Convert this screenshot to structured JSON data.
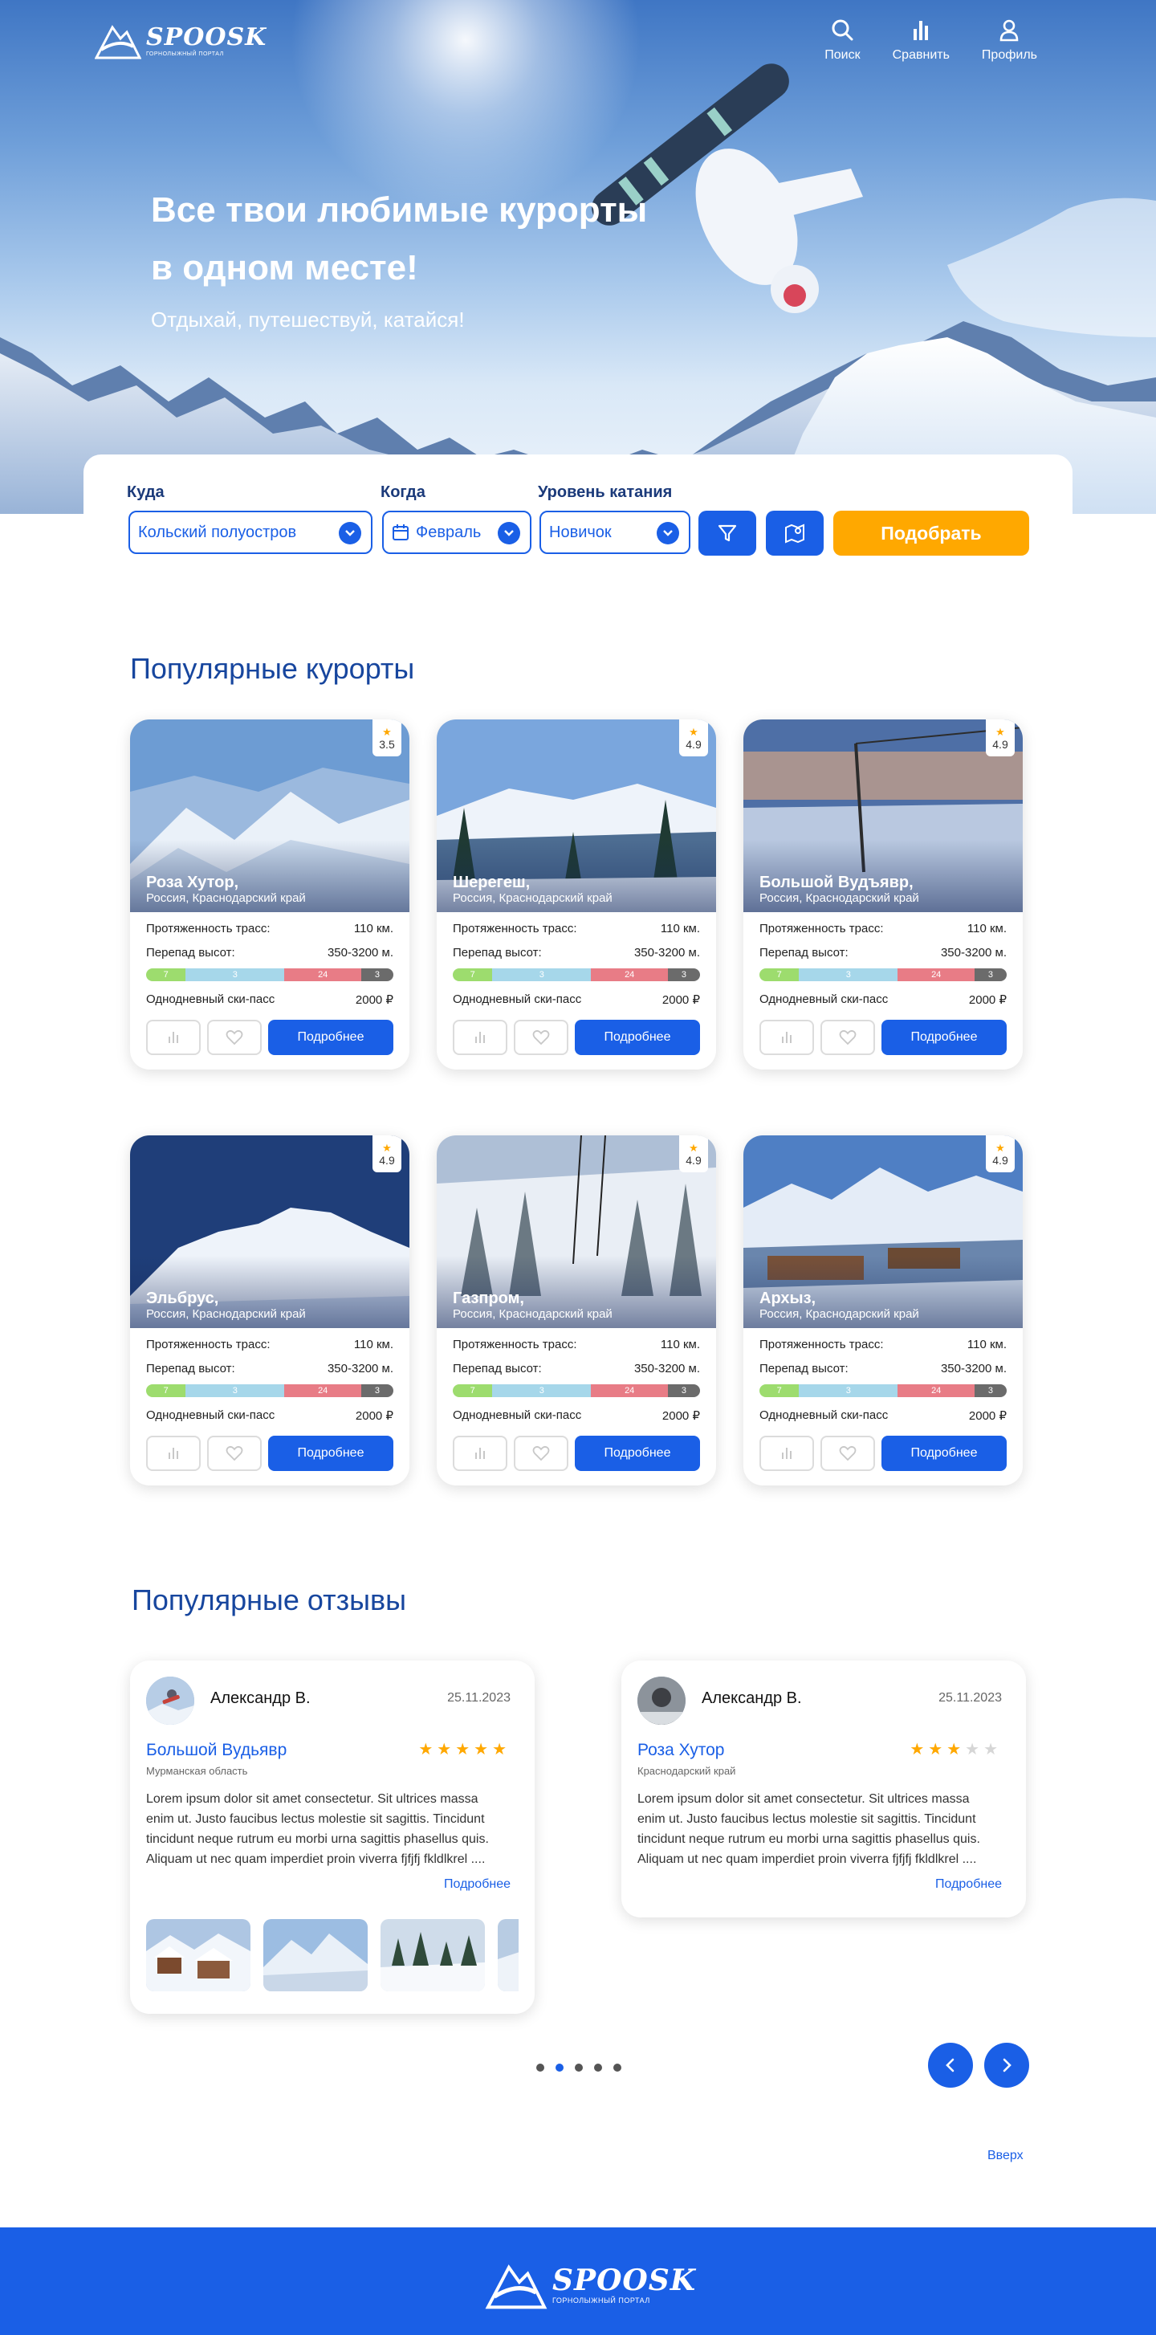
{
  "brand": {
    "name": "SPOOSK",
    "tagline": "ГОРНОЛЫЖНЫЙ ПОРТАЛ",
    "logo_icon": "mountain-ski-logo"
  },
  "nav": [
    {
      "label": "Поиск",
      "icon": "search-icon"
    },
    {
      "label": "Сравнить",
      "icon": "bar-chart-icon"
    },
    {
      "label": "Профиль",
      "icon": "user-icon"
    }
  ],
  "hero": {
    "title": "Все твои любимые курорты в одном месте!",
    "subtitle": "Отдыхай, путешествуй, катайся!"
  },
  "search": {
    "where_label": "Куда",
    "where_value": "Кольский полуостров",
    "when_label": "Когда",
    "when_value": "Февраль",
    "level_label": "Уровень катания",
    "level_value": "Новичок",
    "filter_icon": "filter-icon",
    "map_icon": "map-pin-icon",
    "submit_label": "Подобрать"
  },
  "resorts_section": {
    "title": "Популярные курорты"
  },
  "resort_labels": {
    "length": "Протяженность трасс:",
    "elevation": "Перепад высот:",
    "skipass": "Однодневный ски-пасс",
    "more": "Подробнее"
  },
  "slope_colors": {
    "green": "#9ddc6e",
    "blue": "#a6d7ea",
    "red": "#e87c86",
    "black": "#6b6b6b"
  },
  "resorts": [
    {
      "name": "Роза Хутор,",
      "region": "Россия, Краснодарский край",
      "rating": "3.5",
      "length": "110 км.",
      "elevation": "350-3200 м.",
      "skipass": "2000 ₽",
      "slopes": {
        "green": "7",
        "blue": "3",
        "red": "24",
        "black": "3"
      }
    },
    {
      "name": "Шерегеш,",
      "region": "Россия, Краснодарский край",
      "rating": "4.9",
      "length": "110 км.",
      "elevation": "350-3200 м.",
      "skipass": "2000 ₽",
      "slopes": {
        "green": "7",
        "blue": "3",
        "red": "24",
        "black": "3"
      }
    },
    {
      "name": "Большой Вудъявр,",
      "region": "Россия, Краснодарский край",
      "rating": "4.9",
      "length": "110 км.",
      "elevation": "350-3200 м.",
      "skipass": "2000 ₽",
      "slopes": {
        "green": "7",
        "blue": "3",
        "red": "24",
        "black": "3"
      }
    },
    {
      "name": "Эльбрус,",
      "region": "Россия, Краснодарский край",
      "rating": "4.9",
      "length": "110 км.",
      "elevation": "350-3200 м.",
      "skipass": "2000 ₽",
      "slopes": {
        "green": "7",
        "blue": "3",
        "red": "24",
        "black": "3"
      }
    },
    {
      "name": "Газпром,",
      "region": "Россия, Краснодарский край",
      "rating": "4.9",
      "length": "110 км.",
      "elevation": "350-3200 м.",
      "skipass": "2000 ₽",
      "slopes": {
        "green": "7",
        "blue": "3",
        "red": "24",
        "black": "3"
      }
    },
    {
      "name": "Архыз,",
      "region": "Россия, Краснодарский край",
      "rating": "4.9",
      "length": "110 км.",
      "elevation": "350-3200 м.",
      "skipass": "2000 ₽",
      "slopes": {
        "green": "7",
        "blue": "3",
        "red": "24",
        "black": "3"
      }
    }
  ],
  "reviews_section": {
    "title": "Популярные отзывы"
  },
  "reviews": [
    {
      "author": "Александр В.",
      "date": "25.11.2023",
      "resort": "Большой Вудьявр",
      "area": "Мурманская область",
      "stars": 5,
      "text": "Lorem ipsum dolor sit amet consectetur. Sit ultrices massa enim ut. Justo faucibus lectus molestie sit sagittis. Tincidunt tincidunt neque rutrum eu morbi urna sagittis phasellus quis. Aliquam ut nec quam imperdiet proin viverra fjfjfj fkldlkrel ....",
      "more": "Подробнее"
    },
    {
      "author": "Александр В.",
      "date": "25.11.2023",
      "resort": "Роза Хутор",
      "area": "Краснодарский край",
      "stars": 3,
      "text": "Lorem ipsum dolor sit amet consectetur. Sit ultrices massa enim ut. Justo faucibus lectus molestie sit sagittis. Tincidunt tincidunt neque rutrum eu morbi urna sagittis phasellus quis. Aliquam ut nec quam imperdiet proin viverra fjfjfj fkldlkrel ....",
      "more": "Подробнее"
    }
  ],
  "carousel": {
    "pages": 5,
    "active": 2
  },
  "up_label": "Вверх",
  "colors": {
    "accent": "#1a5fe6",
    "orange": "#ffa800",
    "title": "#17469e"
  }
}
